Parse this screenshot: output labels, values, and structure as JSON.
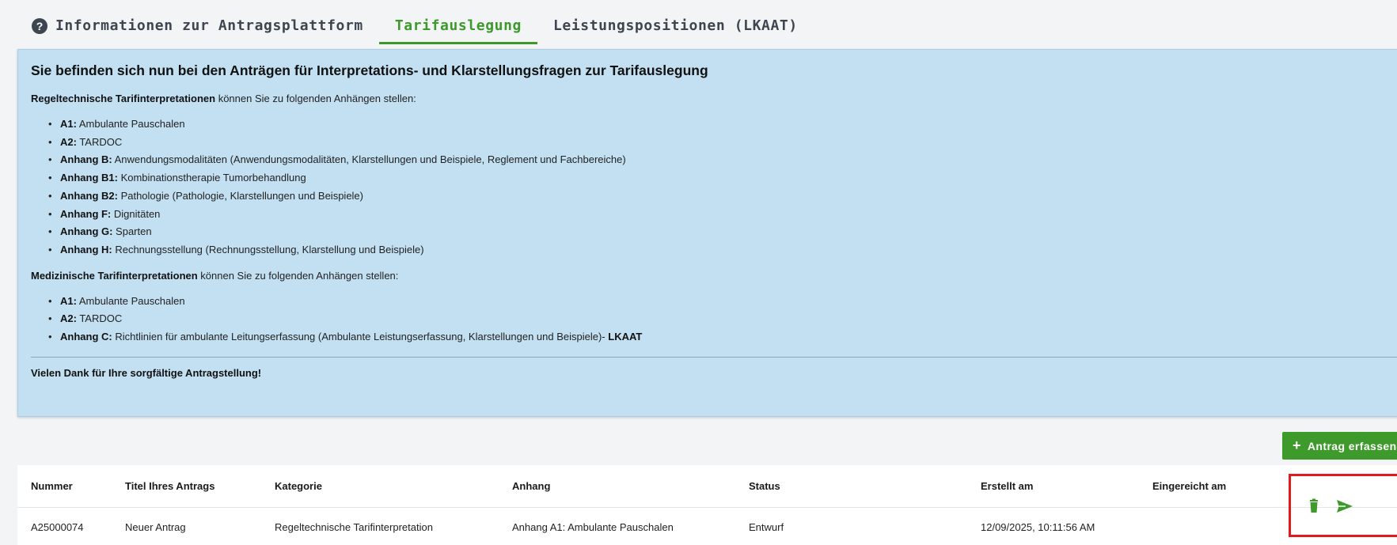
{
  "tabs": [
    {
      "label": "Informationen zur Antragsplattform",
      "icon": "question-circle-icon",
      "active": false
    },
    {
      "label": "Tarifauslegung",
      "active": true
    },
    {
      "label": "Leistungspositionen (LKAAT)",
      "active": false
    }
  ],
  "info": {
    "title": "Sie befinden sich nun bei den Anträgen für Interpretations- und Klarstellungsfragen zur Tarifauslegung",
    "help_icon": "?",
    "intro1_bold": "Regeltechnische Tarifinterpretationen",
    "intro1_rest": " können Sie zu folgenden Anhängen stellen:",
    "list1": [
      {
        "key": "A1:",
        "text": " Ambulante Pauschalen"
      },
      {
        "key": "A2:",
        "text": " TARDOC"
      },
      {
        "key": "Anhang B:",
        "text": " Anwendungsmodalitäten (Anwendungsmodalitäten, Klarstellungen und Beispiele, Reglement und Fachbereiche)"
      },
      {
        "key": "Anhang B1:",
        "text": " Kombinationstherapie Tumorbehandlung"
      },
      {
        "key": "Anhang B2:",
        "text": " Pathologie (Pathologie, Klarstellungen und Beispiele)"
      },
      {
        "key": "Anhang F:",
        "text": " Dignitäten"
      },
      {
        "key": "Anhang G:",
        "text": " Sparten"
      },
      {
        "key": "Anhang H:",
        "text": " Rechnungsstellung (Rechnungsstellung, Klarstellung und Beispiele)"
      }
    ],
    "intro2_bold": "Medizinische Tarifinterpretationen",
    "intro2_rest": " können Sie zu folgenden Anhängen stellen:",
    "list2": [
      {
        "key": "A1:",
        "text": " Ambulante Pauschalen"
      },
      {
        "key": "A2:",
        "text": " TARDOC"
      },
      {
        "key": "Anhang C:",
        "text": " Richtlinien für ambulante Leitungserfassung (Ambulante Leistungserfassung, Klarstellungen und Beispiele)- ",
        "tail_bold": "LKAAT"
      }
    ],
    "thanks": "Vielen Dank für Ihre sorgfältige Antragstellung!"
  },
  "add_button": {
    "icon": "+",
    "label": "Antrag erfassen"
  },
  "table": {
    "headers": [
      "Nummer",
      "Titel Ihres Antrags",
      "Kategorie",
      "Anhang",
      "Status",
      "Erstellt am",
      "Eingereicht am"
    ],
    "rows": [
      [
        "A25000074",
        "Neuer Antrag",
        "Regeltechnische Tarifinterpretation",
        "Anhang A1: Ambulante Pauschalen",
        "Entwurf",
        "12/09/2025, 10:11:56 AM",
        ""
      ]
    ],
    "row_actions": [
      "trash-icon",
      "send-icon"
    ]
  },
  "colors": {
    "accent": "#3c9a2a",
    "info_bg": "#c2e0f2",
    "help_blue": "#2a86c8",
    "highlight_red": "#e01b1b"
  }
}
